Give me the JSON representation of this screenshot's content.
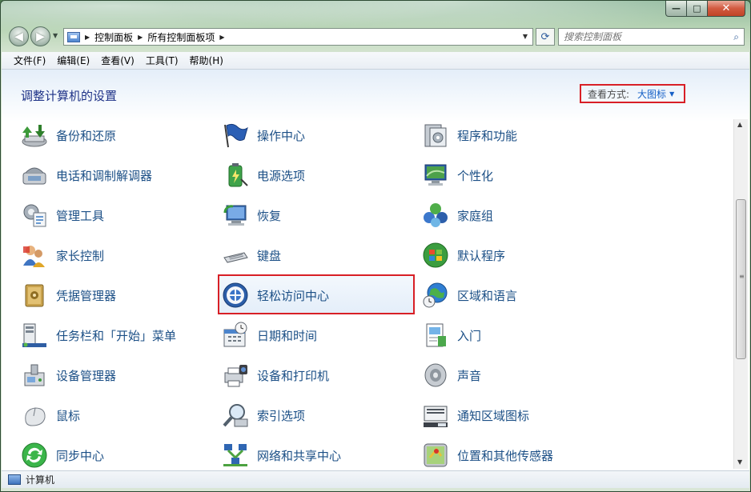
{
  "window": {
    "caption": {
      "minimize": "—",
      "maximize": "□",
      "close": "✕"
    }
  },
  "nav": {
    "back": "◀",
    "forward": "▶",
    "breadcrumbs": [
      "控制面板",
      "所有控制面板项"
    ],
    "search_placeholder": "搜索控制面板"
  },
  "menu": [
    "文件(F)",
    "编辑(E)",
    "查看(V)",
    "工具(T)",
    "帮助(H)"
  ],
  "page": {
    "title": "调整计算机的设置",
    "view_by_label": "查看方式:",
    "view_by_value": "大图标"
  },
  "items": {
    "col1": [
      {
        "label": "备份和还原",
        "icon": "backup-restore-icon"
      },
      {
        "label": "电话和调制解调器",
        "icon": "phone-modem-icon"
      },
      {
        "label": "管理工具",
        "icon": "admin-tools-icon"
      },
      {
        "label": "家长控制",
        "icon": "parental-controls-icon"
      },
      {
        "label": "凭据管理器",
        "icon": "credential-manager-icon"
      },
      {
        "label": "任务栏和「开始」菜单",
        "icon": "taskbar-start-menu-icon"
      },
      {
        "label": "设备管理器",
        "icon": "device-manager-icon"
      },
      {
        "label": "鼠标",
        "icon": "mouse-icon"
      },
      {
        "label": "同步中心",
        "icon": "sync-center-icon"
      }
    ],
    "col2": [
      {
        "label": "操作中心",
        "icon": "action-center-flag-icon"
      },
      {
        "label": "电源选项",
        "icon": "power-options-icon"
      },
      {
        "label": "恢复",
        "icon": "recovery-icon"
      },
      {
        "label": "键盘",
        "icon": "keyboard-icon"
      },
      {
        "label": "轻松访问中心",
        "icon": "ease-of-access-icon"
      },
      {
        "label": "日期和时间",
        "icon": "date-time-icon"
      },
      {
        "label": "设备和打印机",
        "icon": "devices-printers-icon"
      },
      {
        "label": "索引选项",
        "icon": "indexing-options-icon"
      },
      {
        "label": "网络和共享中心",
        "icon": "network-sharing-icon"
      }
    ],
    "col3": [
      {
        "label": "程序和功能",
        "icon": "programs-features-icon"
      },
      {
        "label": "个性化",
        "icon": "personalization-icon"
      },
      {
        "label": "家庭组",
        "icon": "homegroup-icon"
      },
      {
        "label": "默认程序",
        "icon": "default-programs-icon"
      },
      {
        "label": "区域和语言",
        "icon": "region-language-icon"
      },
      {
        "label": "入门",
        "icon": "getting-started-icon"
      },
      {
        "label": "声音",
        "icon": "sound-icon"
      },
      {
        "label": "通知区域图标",
        "icon": "notification-area-icon"
      },
      {
        "label": "位置和其他传感器",
        "icon": "location-sensors-icon"
      }
    ]
  },
  "status": {
    "text": "计算机"
  },
  "colors": {
    "link": "#1b4f86",
    "title": "#1e3287",
    "highlight_border": "#d81f26"
  }
}
